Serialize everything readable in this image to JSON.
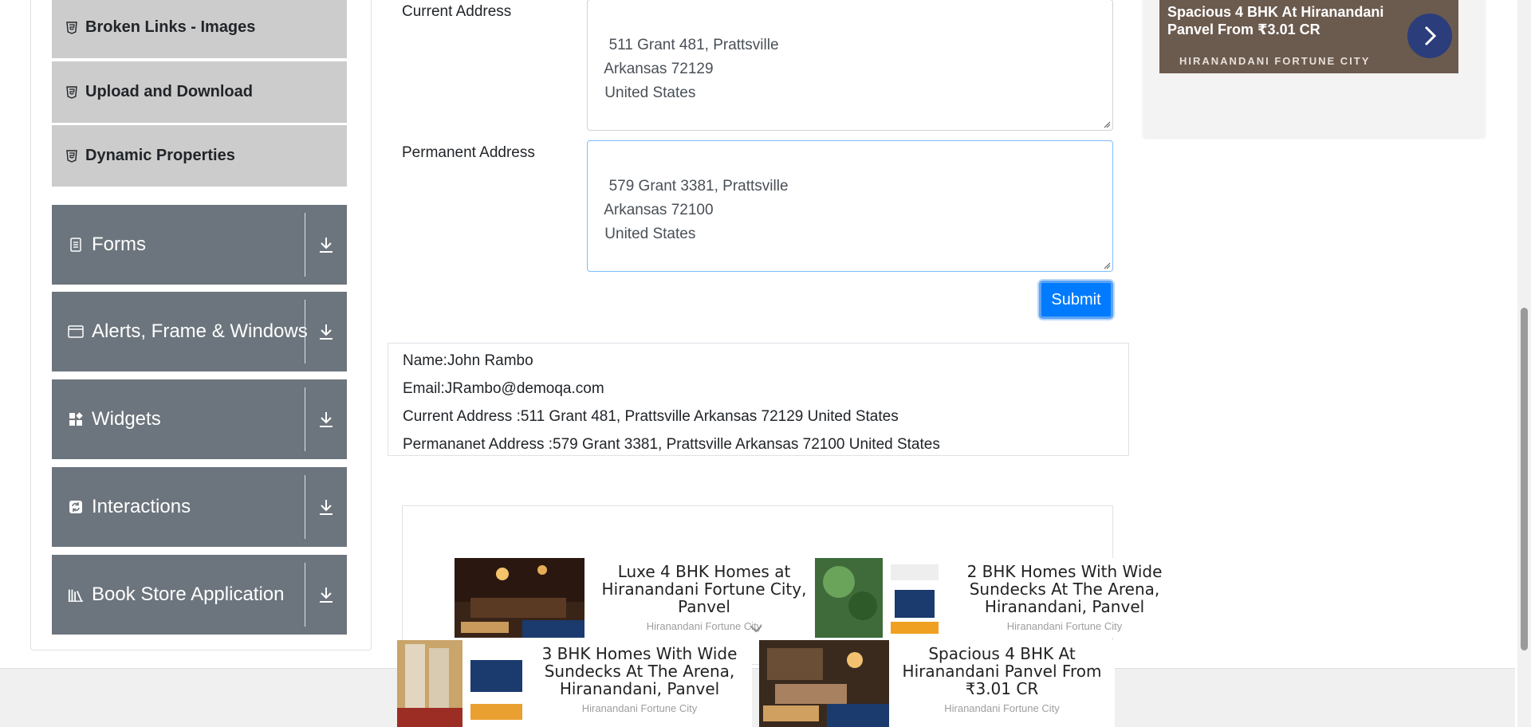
{
  "sidebar": {
    "sub_items": [
      {
        "label": "Broken Links - Images"
      },
      {
        "label": "Upload and Download"
      },
      {
        "label": "Dynamic Properties"
      }
    ],
    "groups": [
      {
        "label": "Forms",
        "icon": "form-icon"
      },
      {
        "label": "Alerts, Frame & Windows",
        "icon": "window-icon"
      },
      {
        "label": "Widgets",
        "icon": "widgets-icon"
      },
      {
        "label": "Interactions",
        "icon": "interactions-icon"
      },
      {
        "label": "Book Store Application",
        "icon": "books-icon"
      }
    ]
  },
  "form": {
    "current_address_label": "Current Address",
    "current_address_value": "511 Grant 481, Prattsville\n Arkansas 72129\n United States",
    "permanent_address_label": "Permanent Address",
    "permanent_address_value": "579 Grant 3381, Prattsville\n Arkansas 72100\n United States",
    "submit_label": "Submit"
  },
  "output": {
    "name": "Name:John Rambo",
    "email": "Email:JRambo@demoqa.com",
    "current_address": "Current Address :511 Grant 481, Prattsville Arkansas 72129 United States",
    "permanent_address": "Permananet Address :579 Grant 3381, Prattsville Arkansas 72100 United States"
  },
  "top_ad": {
    "title": "Spacious 4 BHK At Hiranandani Panvel From ₹3.01 CR",
    "brand": "HIRANANDANI FORTUNE CITY"
  },
  "ads": [
    {
      "title": "Luxe 4 BHK Homes at Hiranandani Fortune City, Panvel",
      "source": "Hiranandani Fortune City"
    },
    {
      "title": "2 BHK Homes With Wide Sundecks At The Arena, Hiranandani, Panvel",
      "source": "Hiranandani Fortune City"
    },
    {
      "title": "3 BHK Homes With Wide Sundecks At The Arena, Hiranandani, Panvel",
      "source": "Hiranandani Fortune City"
    },
    {
      "title": "Spacious 4 BHK At Hiranandani Panvel From ₹3.01 CR",
      "source": "Hiranandani Fortune City"
    }
  ],
  "colors": {
    "primary": "#007bff",
    "sidebar_group": "#6c757d",
    "sidebar_item": "#cccccc"
  }
}
